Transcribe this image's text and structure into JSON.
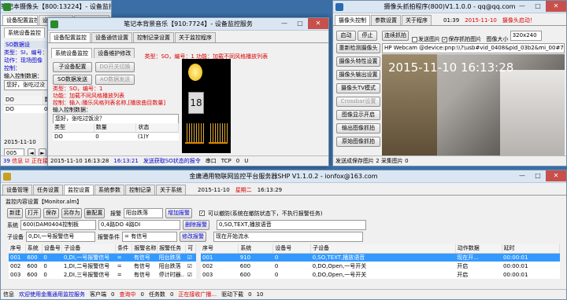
{
  "win1": {
    "title": "笔记本摄像头【800:13224】- 设备监控服务",
    "tabs": [
      "设备配置监控",
      "设备通信设置",
      "控制记录设置",
      "关于监控程序"
    ],
    "subtab": "系统设备监控",
    "items": [
      "SO数据设",
      "类型：SI，编号：",
      "动作：现场图像",
      "控制：",
      "输入控制数据：",
      "您好，张吃过没"
    ],
    "table_headers": [
      "DO",
      "数值"
    ],
    "row1": [
      "DO",
      "0"
    ],
    "status_date": "2015-11-10",
    "status_num1": "005",
    "status_num2": "39",
    "status_tail": "信息 ☑ 正在接收"
  },
  "win2": {
    "title": "笔记本背景音乐【910:7724】- 设备监控服务",
    "tabs": [
      "设备配置监控",
      "设备通信设置",
      "控制记录设置",
      "关于监控程序"
    ],
    "info": "类型：SO，编号：1 功能：加载不同风格播放列表",
    "subtabs": [
      "系统设备监控",
      "设备维护修改"
    ],
    "buttons": [
      "子设备配置",
      "DO开关切换",
      "SO数据发送",
      "AO数据发送"
    ],
    "line1": "类型：SO，编号：1",
    "line2": "功能：加载不同风格播放列表",
    "line3": "控制：输入:播乐风格列表名称,[播放曲目数量]",
    "input_label": "输入控制数据：",
    "input_value": "您好，张吃过饭没？",
    "table_headers": [
      "类型",
      "数量",
      "状态"
    ],
    "row1": [
      "DO",
      "0",
      "(1)Y"
    ],
    "status_date": "2015-11-10 16:13:28",
    "status_time": "16:13:21",
    "status_msg": "发送获取SO状态的报令",
    "status_port": "串口",
    "status_tcp": "TCP",
    "status_tcp_val": "0",
    "status_udp": "U"
  },
  "win3": {
    "title": "摄像头抓拍程序(800)V1.1.0.0 - qq@qq.com",
    "tabs": [
      "摄像头控制",
      "参数设置",
      "关于程序"
    ],
    "time": "01:39",
    "date": "2015-11-10",
    "ready": "摄像头启动！",
    "buttons": [
      "启动",
      "停止",
      "连续抓拍",
      "重新检测摄像头",
      "摄像头特性设置",
      "摄像头输出设置",
      "摄像头TV模式",
      "Crossbar设置",
      "图像显示开启",
      "输出图像抓拍",
      "原始图像抓拍"
    ],
    "chk_send": "发送图片",
    "chk_save": "保存抓拍图片",
    "size_label": "图像大小",
    "size_value": "320x240",
    "device": "HP Webcam @device:pnp:\\\\?\\usb#vid_0408&pid_03b2&mi_00#7&4",
    "overlay": "2015-11-10 16:13:28",
    "status1": "发送成保存图片",
    "status_n1": "2",
    "status_label2": "采集图片",
    "status_n2": "0"
  },
  "win4": {
    "title": "金庸通用物联网监控平台服务器SHP V1.1.0.2 - ionfox@163.com",
    "tabs": [
      "设备管理",
      "任务设置",
      "监控设置",
      "系统参数",
      "控制记录",
      "关于系统"
    ],
    "date": "2015-11-10",
    "weekday": "星期二",
    "time": "16:13:29",
    "config_label": "监控内容设置【Monitor.alm】",
    "toolbar": [
      "新建",
      "打开",
      "保存",
      "另存为",
      "删配置"
    ],
    "alarm_label": "报警",
    "alarm_value": "阳台跌落",
    "add_alarm": "增加报警",
    "chk_label": "可以撤防(系统在撤防状态下，不执行报警任务)",
    "dev_label": "系统",
    "dev_value": "600(DAM0404控制板",
    "sub_value": "0,4路DO 4路DI",
    "cond_value": "0,SO,TEXT,播放语音",
    "del_alarm": "删除报警",
    "sub_label": "子设备",
    "sub2_value": "0,DI,一号报警信号",
    "cond_label": "报警条件",
    "cond2_value": "= 有信号",
    "edit_alarm": "修改报警",
    "now_exec": "现在开始流水",
    "lt_headers": [
      "序号",
      "系统",
      "设备号",
      "子设备",
      "条件",
      "报警名称",
      "报警任务",
      "可"
    ],
    "lt_rows": [
      [
        "001",
        "600",
        "0",
        "0,DI,一号报警信号",
        "=",
        "有信号",
        "阳台跌落",
        "☑"
      ],
      [
        "002",
        "600",
        "0",
        "1,DI,二号报警信号",
        "=",
        "有信号",
        "阳台跌落",
        "☑"
      ],
      [
        "003",
        "600",
        "0",
        "2,DI,三号报警信号",
        "=",
        "有信号",
        "停计时器..",
        "☑"
      ]
    ],
    "rt_headers": [
      "序号",
      "系统",
      "设备号",
      "子设备",
      "动作数据",
      "延时"
    ],
    "rt_rows": [
      [
        "001",
        "910",
        "0",
        "0,SO,TEXT,播放语音",
        "现在开...",
        "00:00:01"
      ],
      [
        "002",
        "600",
        "0",
        "0,DO,Open,一号开关",
        "开启",
        "00:00:01"
      ],
      [
        "003",
        "600",
        "0",
        "0,DO,Open,一号开关",
        "开启",
        "00:00:01"
      ]
    ],
    "status": [
      "信息",
      "欢迎使用金鹰通用监控服务",
      "客户端",
      "0",
      "查询中",
      "0",
      "任务数",
      "0",
      "正在接收广播...",
      "驱动下载",
      "0",
      "10"
    ]
  }
}
